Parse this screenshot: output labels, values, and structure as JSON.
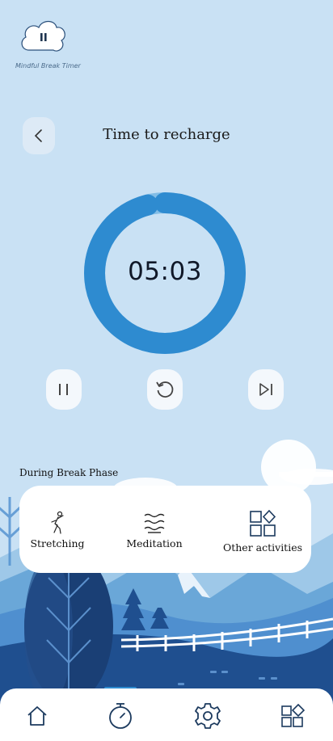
{
  "app": {
    "caption": "Mindful Break Timer"
  },
  "header": {
    "title": "Time to recharge"
  },
  "timer": {
    "display": "05:03",
    "progress": 0.96
  },
  "phase": {
    "label": "During Break Phase"
  },
  "activities": [
    {
      "label": "Stretching",
      "icon": "stretching-icon"
    },
    {
      "label": "Meditation",
      "icon": "meditation-icon"
    },
    {
      "label": "Other activities",
      "icon": "other-activities-icon"
    }
  ],
  "controls": [
    "pause-icon",
    "restart-icon",
    "skip-icon"
  ],
  "nav": [
    "home-icon",
    "timer-icon",
    "gear-icon",
    "apps-icon"
  ],
  "colors": {
    "accent": "#2e8bd0",
    "ring_track": "#82bde6",
    "background": "#c9e1f4",
    "illustration_dark": "#1f4f8f"
  }
}
